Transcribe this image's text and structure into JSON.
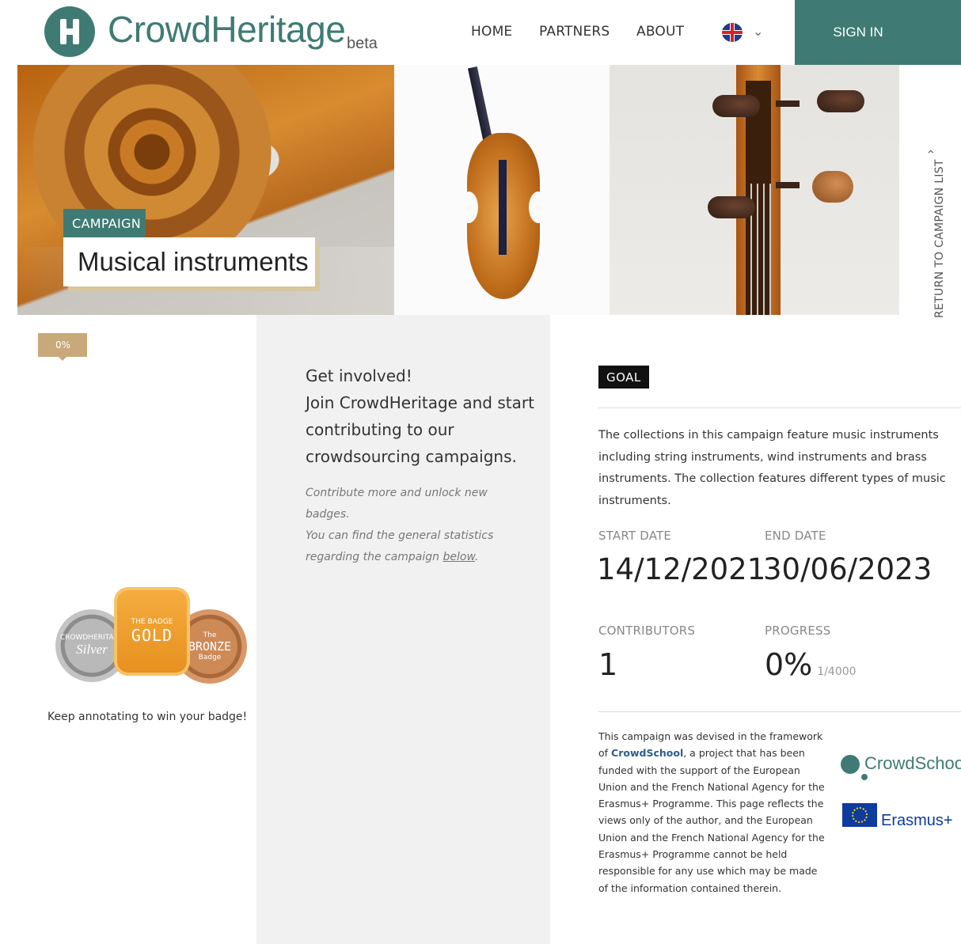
{
  "header": {
    "logo_text": "CrowdHeritage",
    "logo_badge": "beta",
    "nav": [
      "HOME",
      "PARTNERS",
      "ABOUT"
    ],
    "language": "en-flag-icon",
    "signin_label": "SIGN IN",
    "brand_color": "#3f7b74"
  },
  "banner": {
    "tag": "CAMPAIGN",
    "title": "Musical instruments",
    "progress_label": "0%",
    "return_label": "RETURN TO CAMPAIGN LIST"
  },
  "badges": {
    "silver": {
      "small": "CROWDHERITAGE",
      "name": "Silver"
    },
    "gold": {
      "small": "THE BADGE",
      "name": "GOLD"
    },
    "bronze": {
      "small": "The",
      "name": "BRONZE",
      "sub": "Badge"
    },
    "caption": "Keep annotating to win your badge!"
  },
  "involve": {
    "heading": "Get involved!\nJoin CrowdHeritage and start contributing to our crowdsourcing campaigns.",
    "note_1": "Contribute more and unlock new badges.",
    "note_2": "You can find the general statistics regarding the campaign ",
    "note_link": "below",
    "note_end": "."
  },
  "goal": {
    "tag": "GOAL",
    "description": "The collections in this campaign feature music instruments including string instruments, wind instruments and brass instruments. The collection features different types of music instruments."
  },
  "stats": {
    "start_label": "START DATE",
    "start_value": "14/12/2021",
    "end_label": "END DATE",
    "end_value": "30/06/2023",
    "contributors_label": "CONTRIBUTORS",
    "contributors_value": "1",
    "progress_label": "PROGRESS",
    "progress_value": "0%",
    "progress_sub": "1/4000"
  },
  "credit": {
    "before": "This campaign was devised in the framework of ",
    "link": "CrowdSchool",
    "after": ", a project that has been funded with the support of the European Union and the French National Agency for the Erasmus+ Programme. This page reflects the views only of the author, and the European Union and the French National Agency for the Erasmus+ Programme cannot be held responsible for any use which may be made of the information contained therein.",
    "logo_crowdschool": "CrowdSchool",
    "logo_erasmus": "Erasmus+"
  }
}
